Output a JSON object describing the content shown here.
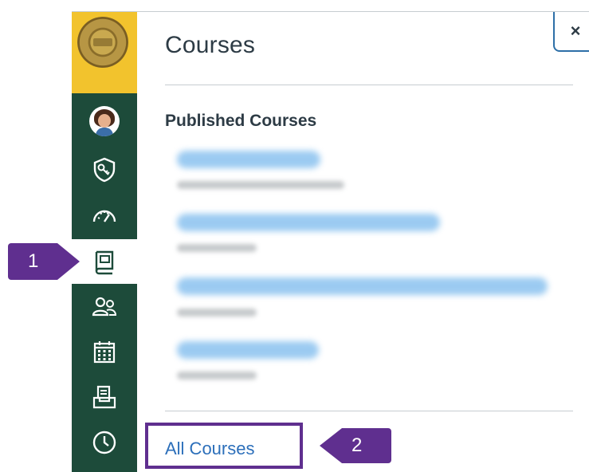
{
  "tray": {
    "title": "Courses",
    "close_glyph": "×",
    "section_title": "Published Courses",
    "all_courses_label": "All Courses"
  },
  "nav": {
    "items": [
      {
        "icon": "avatar"
      },
      {
        "icon": "shield-key-icon"
      },
      {
        "icon": "dashboard-gauge-icon"
      },
      {
        "icon": "courses-book-icon",
        "active": true
      },
      {
        "icon": "groups-people-icon"
      },
      {
        "icon": "calendar-icon"
      },
      {
        "icon": "inbox-tray-icon"
      },
      {
        "icon": "history-clock-icon"
      }
    ]
  },
  "callouts": {
    "one": "1",
    "two": "2"
  },
  "colors": {
    "nav_bg": "#1d4b3a",
    "logo_bg": "#f2c32d",
    "callout": "#5f2f8f",
    "link": "#2c6fba"
  }
}
